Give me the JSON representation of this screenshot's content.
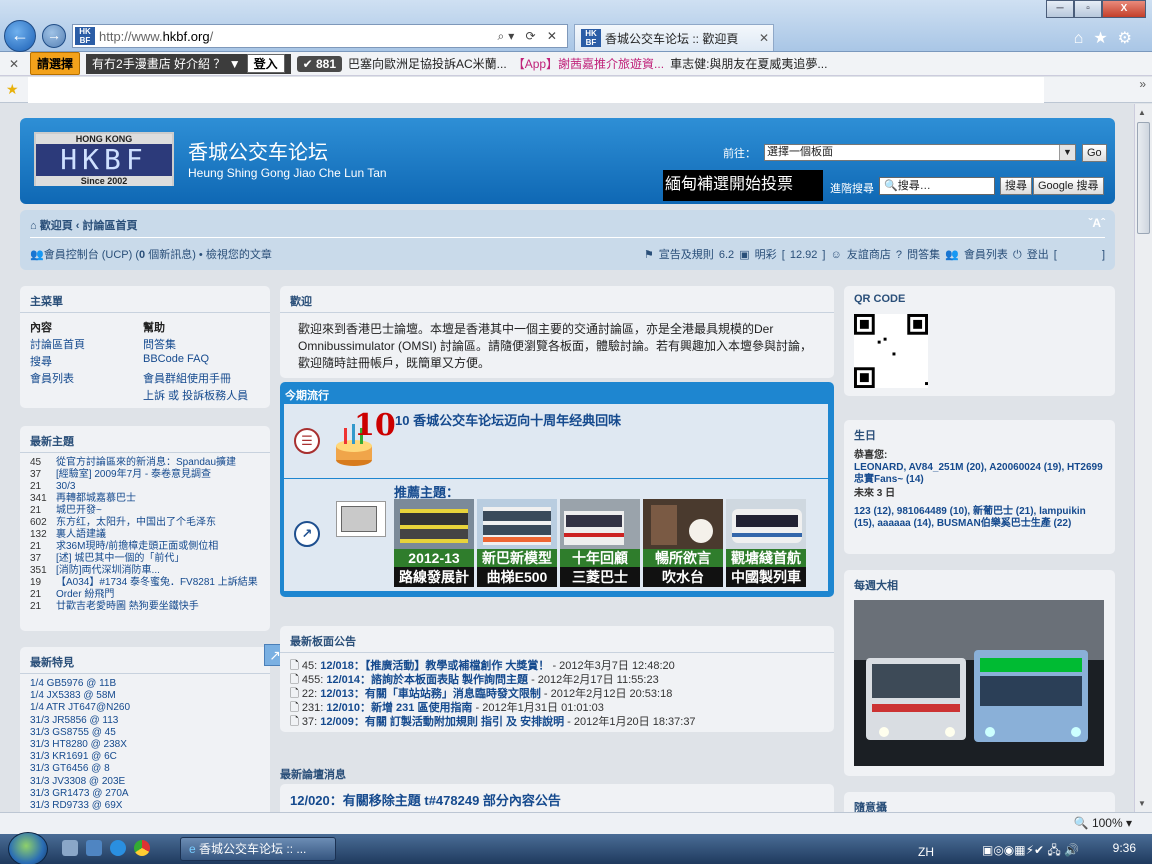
{
  "browser": {
    "address": "http://www.hkbf.org/",
    "address_prefix": "http://www.",
    "address_domain": "hkbf.org",
    "address_suffix": "/",
    "tab_title": "香城公交车论坛 :: 歡迎頁",
    "window_close": "X",
    "nav_icons": [
      "home-icon",
      "star-icon",
      "gear-icon"
    ]
  },
  "toolbar": {
    "select_label": "請選擇",
    "promo_text": "有冇2手漫畫店 好介紹 ？",
    "login_label": "登入",
    "count": "881",
    "fav1": "巴塞向歐洲足協投訴AC米蘭...",
    "fav2": "【App】謝茜嘉推介旅遊資...",
    "fav3": "車志健:與朋友在夏威夷追夢..."
  },
  "header": {
    "logo_top": "HONG KONG",
    "logo_main": "HKBF",
    "logo_since": "Since 2002",
    "title": "香城公交车论坛",
    "subtitle": "Heung Shing Gong Jiao Che Lun Tan",
    "goto_label": "前往：",
    "goto_value": "選擇一個板面",
    "go_button": "Go",
    "banner_text": "緬甸補選開始投票",
    "adv_search": "進階搜尋",
    "search_placeholder": "搜尋…",
    "search_button": "搜尋",
    "google_button": "Google 搜尋"
  },
  "breadcrumb": {
    "home": "歡迎頁",
    "index": "討論區首頁",
    "font_size": "A"
  },
  "userbar": {
    "ucp": "會員控制台 (UCP) (",
    "ucp_count": "0",
    "ucp_rest": " 個新訊息) • 檢視您的文章",
    "rules": "宣告及規則 6.2",
    "money_label": "明彩 [ 12.92 ]",
    "shop": "友誼商店",
    "faq": "問答集",
    "members": "會員列表",
    "logout": "登出 [",
    "logout_end": "]"
  },
  "main_menu": {
    "title": "主菜單",
    "col1_head": "內容",
    "col2_head": "幫助",
    "items": [
      [
        "討論區首頁",
        "問答集"
      ],
      [
        "搜尋",
        "BBCode FAQ"
      ],
      [
        "會員列表",
        "會員群組使用手冊"
      ],
      [
        "",
        "上訴 或 投訴板務人員"
      ]
    ]
  },
  "latest_topics": {
    "title": "最新主題",
    "rows": [
      {
        "n": "45",
        "t": "從官方討論區來的新消息：Spandau擴建"
      },
      {
        "n": "37",
        "t": "[經驗室] 2009年7月 - 泰卷意見調查"
      },
      {
        "n": "21",
        "t": "30/3"
      },
      {
        "n": "341",
        "t": "再轉都城嘉慕巴士"
      },
      {
        "n": "21",
        "t": "城巴开發~"
      },
      {
        "n": "602",
        "t": "东方红，太阳升，中国出了个毛泽东"
      },
      {
        "n": "132",
        "t": "裏人語建議"
      },
      {
        "n": "21",
        "t": "求36M現時/前擔樟走頭正面或側位相"
      },
      {
        "n": "37",
        "t": "[述] 城巴其中一個的「前代」"
      },
      {
        "n": "351",
        "t": "[消防]両代深圳消防車..."
      },
      {
        "n": "19",
        "t": "【A034】#1734 泰冬蜜兔．FV8281 上訴結果"
      },
      {
        "n": "21",
        "t": "Order 紛飛門"
      },
      {
        "n": "21",
        "t": "廿歡吉老愛時圖 熱狗要坐鐵快手"
      }
    ]
  },
  "latest_spotting": {
    "title": "最新特見",
    "rows": [
      "1/4 GB5976 @ 11B",
      "1/4 JX5383 @ 58M",
      "1/4 ATR JT647@N260",
      "31/3 JR5856 @ 113",
      "31/3 GS8755 @ 45",
      "31/3 HT8280 @ 238X",
      "31/3 KR1691 @ 6C",
      "31/3 GT6456 @ 8",
      "31/3 JV3308 @ 203E",
      "31/3 GR1473 @ 270A",
      "31/3 RD9733 @ 69X"
    ]
  },
  "welcome": {
    "title": "歡迎",
    "body": "歡迎來到香港巴士論壇。本壇是香港其中一個主要的交通討論區，亦是全港最具規模的Der Omnibussimulator (OMSI) 討論區。請隨便瀏覽各板面，體驗討論。若有興趣加入本壇參與討論，歡迎隨時註冊帳戶，既簡單又方便。"
  },
  "featured": {
    "title": "今期流行",
    "main_title": "10 香城公交车论坛迈向十周年经典回味",
    "cake_number": "10",
    "recommend_label": "推薦主題：",
    "thumbs": [
      {
        "cap1": "2012-13",
        "cap2": "路線發展計劃",
        "color": "#2f7d2c"
      },
      {
        "cap1": "新巴新模型",
        "cap2": "曲梯E500",
        "color": "#2f7d2c"
      },
      {
        "cap1": "十年回顧",
        "cap2": "三菱巴士",
        "color": "#2f7d2c"
      },
      {
        "cap1": "暢所欲言",
        "cap2": "吹水台",
        "color": "#2f7d2c"
      },
      {
        "cap1": "觀塘綫首航",
        "cap2": "中國製列車",
        "color": "#2f7d2c"
      }
    ]
  },
  "announcements": {
    "title": "最新板面公告",
    "rows": [
      {
        "num": "45:",
        "title": "12/018：【推廣活動】教學或補檔創作 大獎賞！",
        "date": " - 2012年3月7日 12:48:20"
      },
      {
        "num": "455:",
        "title": "12/014：諮詢於本板面表貼 製作詢問主題",
        "date": " - 2012年2月17日 11:55:23"
      },
      {
        "num": "22:",
        "title": "12/013：有關「車站站務」消息臨時發文限制",
        "date": " - 2012年2月12日 20:53:18"
      },
      {
        "num": "231:",
        "title": "12/010：新增 231 區使用指南",
        "date": " - 2012年1月31日 01:01:03"
      },
      {
        "num": "37:",
        "title": "12/009：有關 訂製活動附加規則 指引 及 安排說明",
        "date": " - 2012年1月20日 18:37:37"
      }
    ]
  },
  "latest_news": {
    "title": "最新論壇消息",
    "headline": "12/020：有關移除主題 t#478249 部分內容公告"
  },
  "qr": {
    "title": "QR CODE"
  },
  "birthday": {
    "title": "生日",
    "today_label": "恭喜您:",
    "today": "LEONARD, AV84_251M (20), A20060024 (19), HT2699忠實Fans~ (14)",
    "upcoming_label": "未來 3 日",
    "upcoming": "123 (12), 981064489 (10), 新葡巴士 (21), lampuikin (15), aaaaaa (14), BUSMAN伯樂奚巴士生產 (22)"
  },
  "weekly_photo": {
    "title": "每週大相"
  },
  "random": {
    "title": "隨意攝"
  },
  "status": {
    "zoom": "100%"
  },
  "taskbar": {
    "task": "香城公交车论坛 :: ...",
    "lang": "ZH",
    "time": "9:36"
  }
}
